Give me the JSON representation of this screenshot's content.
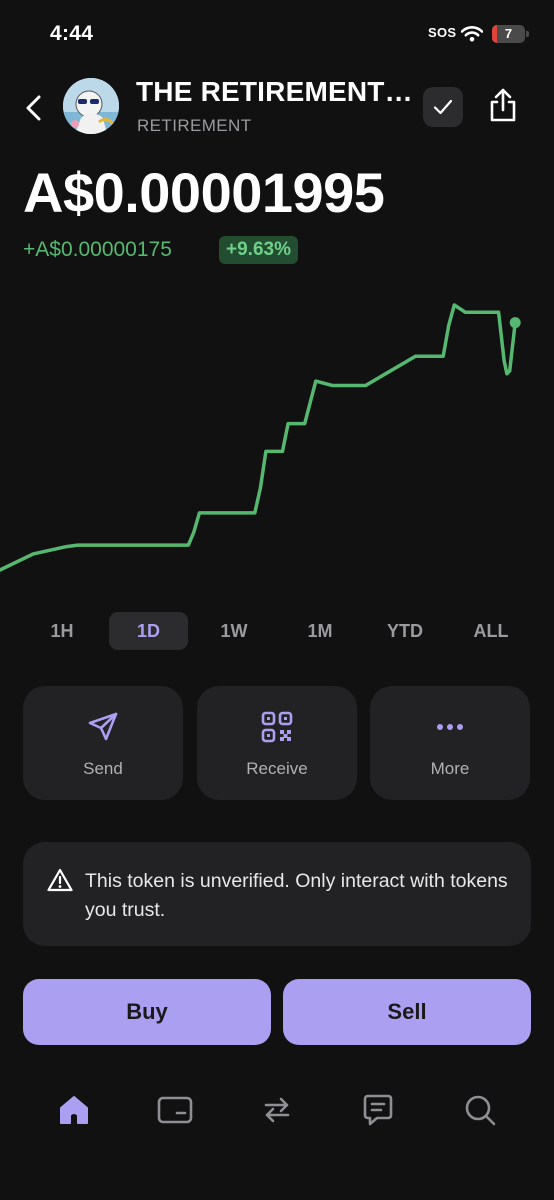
{
  "status_bar": {
    "time": "4:44",
    "sos": "SOS",
    "battery": "7"
  },
  "header": {
    "title": "THE RETIREMENT…",
    "subtitle": "RETIREMENT"
  },
  "price": {
    "value": "A$0.00001995",
    "change": "+A$0.00000175",
    "change_pct": "+9.63%"
  },
  "colors": {
    "accent": "#ab9ff2",
    "positive": "#56b870",
    "background": "#111111",
    "card": "#222224"
  },
  "chart_data": {
    "type": "line",
    "x": [
      0,
      6,
      12,
      14,
      18,
      22,
      26,
      30,
      32,
      34,
      35,
      36,
      42,
      46,
      47,
      48,
      50,
      51,
      52,
      55,
      57,
      60,
      62,
      66,
      75,
      80,
      81,
      82,
      84,
      86,
      89,
      90,
      91,
      91.5,
      92,
      93
    ],
    "values": [
      1.826e-05,
      1.837e-05,
      1.842e-05,
      1.843e-05,
      1.843e-05,
      1.843e-05,
      1.843e-05,
      1.843e-05,
      1.843e-05,
      1.843e-05,
      1.852e-05,
      1.865e-05,
      1.865e-05,
      1.865e-05,
      1.882e-05,
      1.907e-05,
      1.907e-05,
      1.907e-05,
      1.926e-05,
      1.926e-05,
      1.955e-05,
      1.952e-05,
      1.952e-05,
      1.952e-05,
      1.972e-05,
      1.972e-05,
      1.993e-05,
      2.007e-05,
      2.002e-05,
      2.002e-05,
      2.002e-05,
      2.002e-05,
      1.969e-05,
      1.96e-05,
      1.962e-05,
      1.995e-05
    ],
    "xlabel": "",
    "ylabel": "",
    "grid": false,
    "legend": "none",
    "color": "#56b870"
  },
  "time_ranges": [
    "1H",
    "1D",
    "1W",
    "1M",
    "YTD",
    "ALL"
  ],
  "selected_range": "1D",
  "actions": [
    {
      "label": "Send",
      "icon": "send-icon"
    },
    {
      "label": "Receive",
      "icon": "qr-code-icon"
    },
    {
      "label": "More",
      "icon": "more-dots-icon"
    }
  ],
  "warning": {
    "text": "This token is unverified. Only interact with tokens you trust.",
    "icon": "warning-triangle-icon"
  },
  "trade": {
    "buy": "Buy",
    "sell": "Sell"
  },
  "nav": [
    {
      "icon": "home-icon",
      "active": true
    },
    {
      "icon": "wallet-card-icon",
      "active": false
    },
    {
      "icon": "swap-icon",
      "active": false
    },
    {
      "icon": "chat-icon",
      "active": false
    },
    {
      "icon": "search-icon",
      "active": false
    }
  ]
}
